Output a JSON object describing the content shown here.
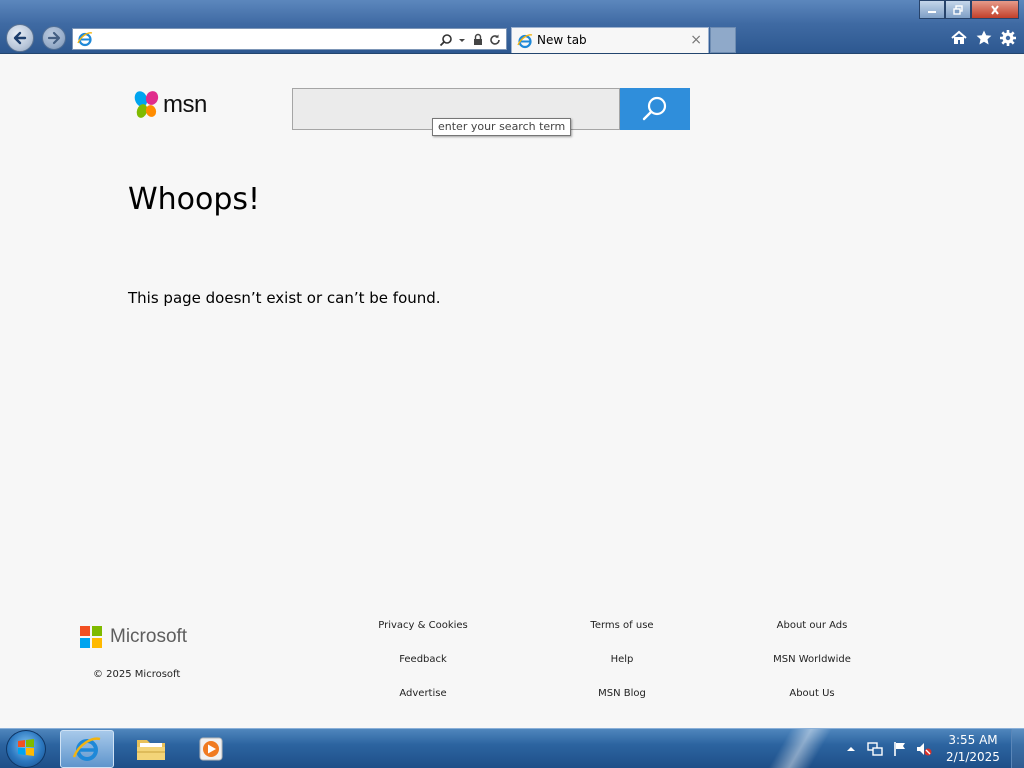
{
  "browser": {
    "address_value": "",
    "tab_label": "New tab"
  },
  "page": {
    "search_placeholder": "",
    "search_tooltip": "enter your search term",
    "logo_text": "msn",
    "heading": "Whoops!",
    "message": "This page doesn’t exist or can’t be found.",
    "brand_color": "#2f8edb"
  },
  "footer": {
    "brand": "Microsoft",
    "copyright": "© 2025 Microsoft",
    "columns": [
      [
        "Privacy & Cookies",
        "Feedback",
        "Advertise"
      ],
      [
        "Terms of use",
        "Help",
        "MSN Blog"
      ],
      [
        "About our Ads",
        "MSN Worldwide",
        "About Us"
      ]
    ]
  },
  "taskbar": {
    "time": "3:55 AM",
    "date": "2/1/2025",
    "pinned_apps": [
      "internet-explorer",
      "windows-explorer",
      "media-player"
    ]
  }
}
